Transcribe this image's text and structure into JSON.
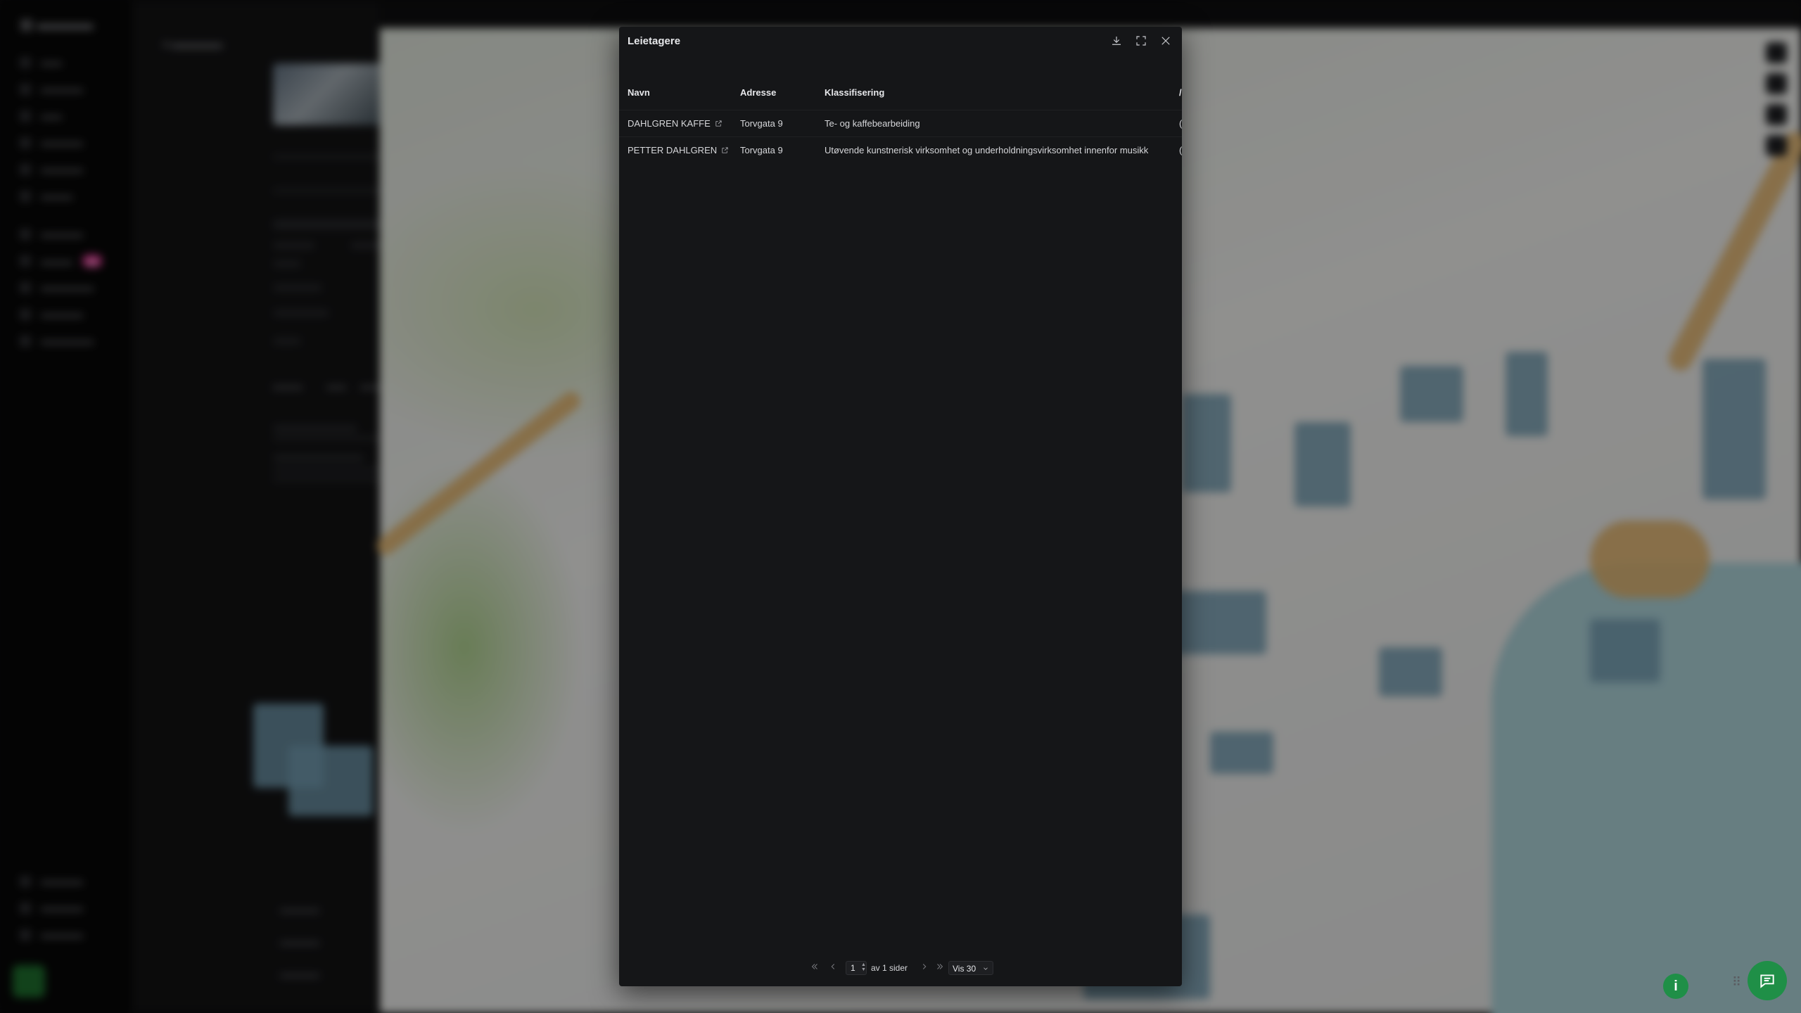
{
  "modal": {
    "title": "Leietagere",
    "columns": [
      "Navn",
      "Adresse",
      "Klassifisering"
    ],
    "rows": [
      {
        "name": "DAHLGREN KAFFE",
        "address": "Torvgata 9",
        "classification": "Te- og kaffebearbeiding"
      },
      {
        "name": "PETTER DAHLGREN",
        "address": "Torvgata 9",
        "classification": "Utøvende kunstnerisk virksomhet og underholdningsvirksomhet innenfor musikk"
      }
    ],
    "icons": {
      "download": "download-icon",
      "fullscreen": "fullscreen-icon",
      "close": "close-icon",
      "external": "external-link-icon"
    }
  },
  "pagination": {
    "page": "1",
    "of_pages": "av 1 sider",
    "page_size": "Vis 30"
  },
  "colors": {
    "modal_bg": "#151618",
    "accent_green": "#1f8f47"
  }
}
